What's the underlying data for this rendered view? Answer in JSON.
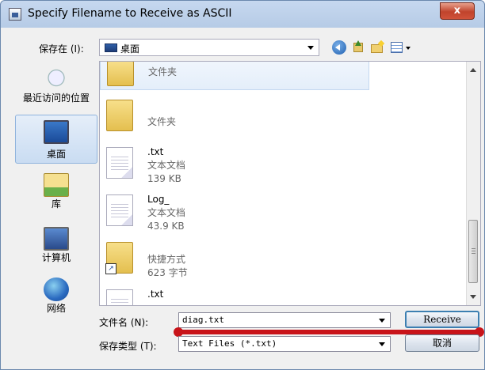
{
  "window": {
    "title": "Specify Filename to Receive as ASCII",
    "close": "x"
  },
  "toolbar": {
    "look_in_label": "保存在 (I):",
    "look_in_value": "桌面",
    "buttons": [
      "back-icon",
      "up-folder-icon",
      "new-folder-icon",
      "view-menu-icon"
    ]
  },
  "places": [
    {
      "label": "最近访问的位置",
      "icon": "recent-places-icon"
    },
    {
      "label": "桌面",
      "icon": "desktop-icon",
      "selected": true
    },
    {
      "label": "库",
      "icon": "libraries-icon"
    },
    {
      "label": "计算机",
      "icon": "computer-icon"
    },
    {
      "label": "网络",
      "icon": "network-icon"
    }
  ],
  "files": [
    {
      "name": "",
      "type": "文件夹",
      "size": "",
      "icon": "folder-icon"
    },
    {
      "name": "",
      "type": "文件夹",
      "size": "",
      "icon": "folder-icon"
    },
    {
      "name": ".txt",
      "type": "文本文档",
      "size": "139 KB",
      "icon": "text-document-icon"
    },
    {
      "name": "Log_",
      "type": "文本文档",
      "size": "43.9 KB",
      "icon": "text-document-icon"
    },
    {
      "name": "",
      "type": "快捷方式",
      "size": "623 字节",
      "icon": "shortcut-icon"
    },
    {
      "name": ".txt",
      "type": "",
      "size": "",
      "icon": "text-document-icon"
    }
  ],
  "form": {
    "filename_label": "文件名 (N):",
    "filename_value": "diag.txt",
    "filetype_label": "保存类型 (T):",
    "filetype_value": "Text Files (*.txt)",
    "receive_label": "Receive",
    "cancel_label": "取消"
  },
  "colors": {
    "highlight_underline": "#c8141a",
    "title_bar": "#b6cbe6",
    "close_button": "#c0432c"
  }
}
